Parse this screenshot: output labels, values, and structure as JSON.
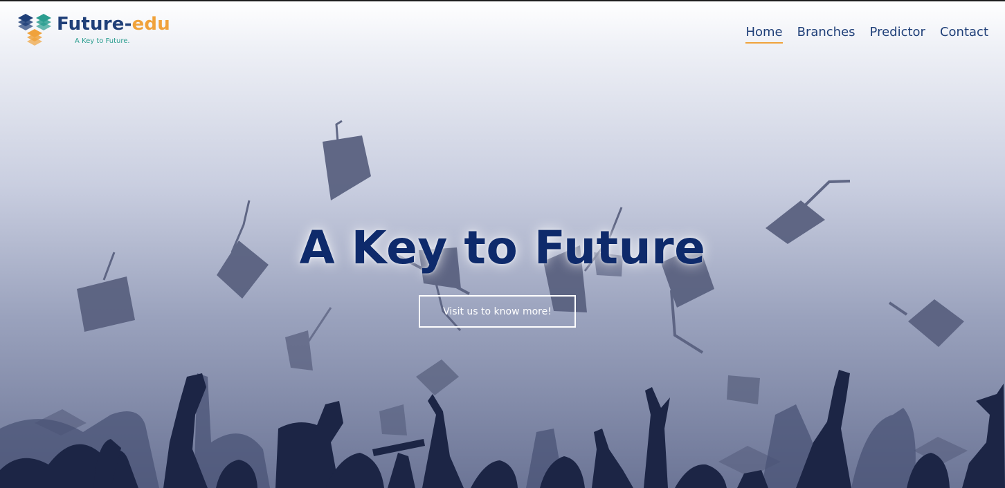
{
  "header": {
    "brand_part1": "Future-",
    "brand_part2": "edu",
    "tagline": "A Key to Future.",
    "nav": [
      {
        "label": "Home",
        "active": true
      },
      {
        "label": "Branches",
        "active": false
      },
      {
        "label": "Predictor",
        "active": false
      },
      {
        "label": "Contact",
        "active": false
      }
    ]
  },
  "hero": {
    "title": "A Key to Future",
    "cta_label": "Visit us to know more!",
    "background_image": "graduation-caps-thrown-crowd-silhouette"
  },
  "colors": {
    "brand_blue": "#1f3f78",
    "brand_orange": "#f0a23b",
    "brand_teal": "#2a9d8f",
    "title_navy": "#0e2a6b",
    "silhouette": "#1c2545"
  }
}
